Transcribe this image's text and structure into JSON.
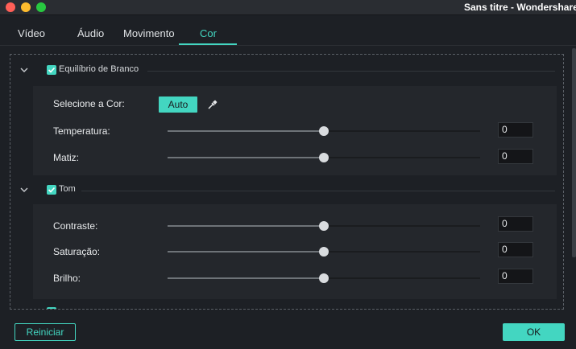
{
  "window": {
    "title": "Sans titre - Wondershare Fi"
  },
  "tabs": [
    {
      "label": "Vídeo"
    },
    {
      "label": "Áudio"
    },
    {
      "label": "Movimento"
    },
    {
      "label": "Cor"
    }
  ],
  "active_tab": "Cor",
  "sections": {
    "white_balance": {
      "label": "Equilíbrio de Branco",
      "checked": true,
      "select_color_label": "Selecione a Cor:",
      "auto_label": "Auto",
      "rows": [
        {
          "label": "Temperatura:",
          "value": "0",
          "slider_fraction": 0.5
        },
        {
          "label": "Matiz:",
          "value": "0",
          "slider_fraction": 0.5
        }
      ]
    },
    "tone": {
      "label": "Tom",
      "checked": true,
      "rows": [
        {
          "label": "Contraste:",
          "value": "0",
          "slider_fraction": 0.5
        },
        {
          "label": "Saturação:",
          "value": "0",
          "slider_fraction": 0.5
        },
        {
          "label": "Brilho:",
          "value": "0",
          "slider_fraction": 0.5
        }
      ]
    }
  },
  "footer": {
    "reset_label": "Reiniciar",
    "ok_label": "OK"
  },
  "colors": {
    "accent": "#43d6c1",
    "background": "#1d2025"
  }
}
